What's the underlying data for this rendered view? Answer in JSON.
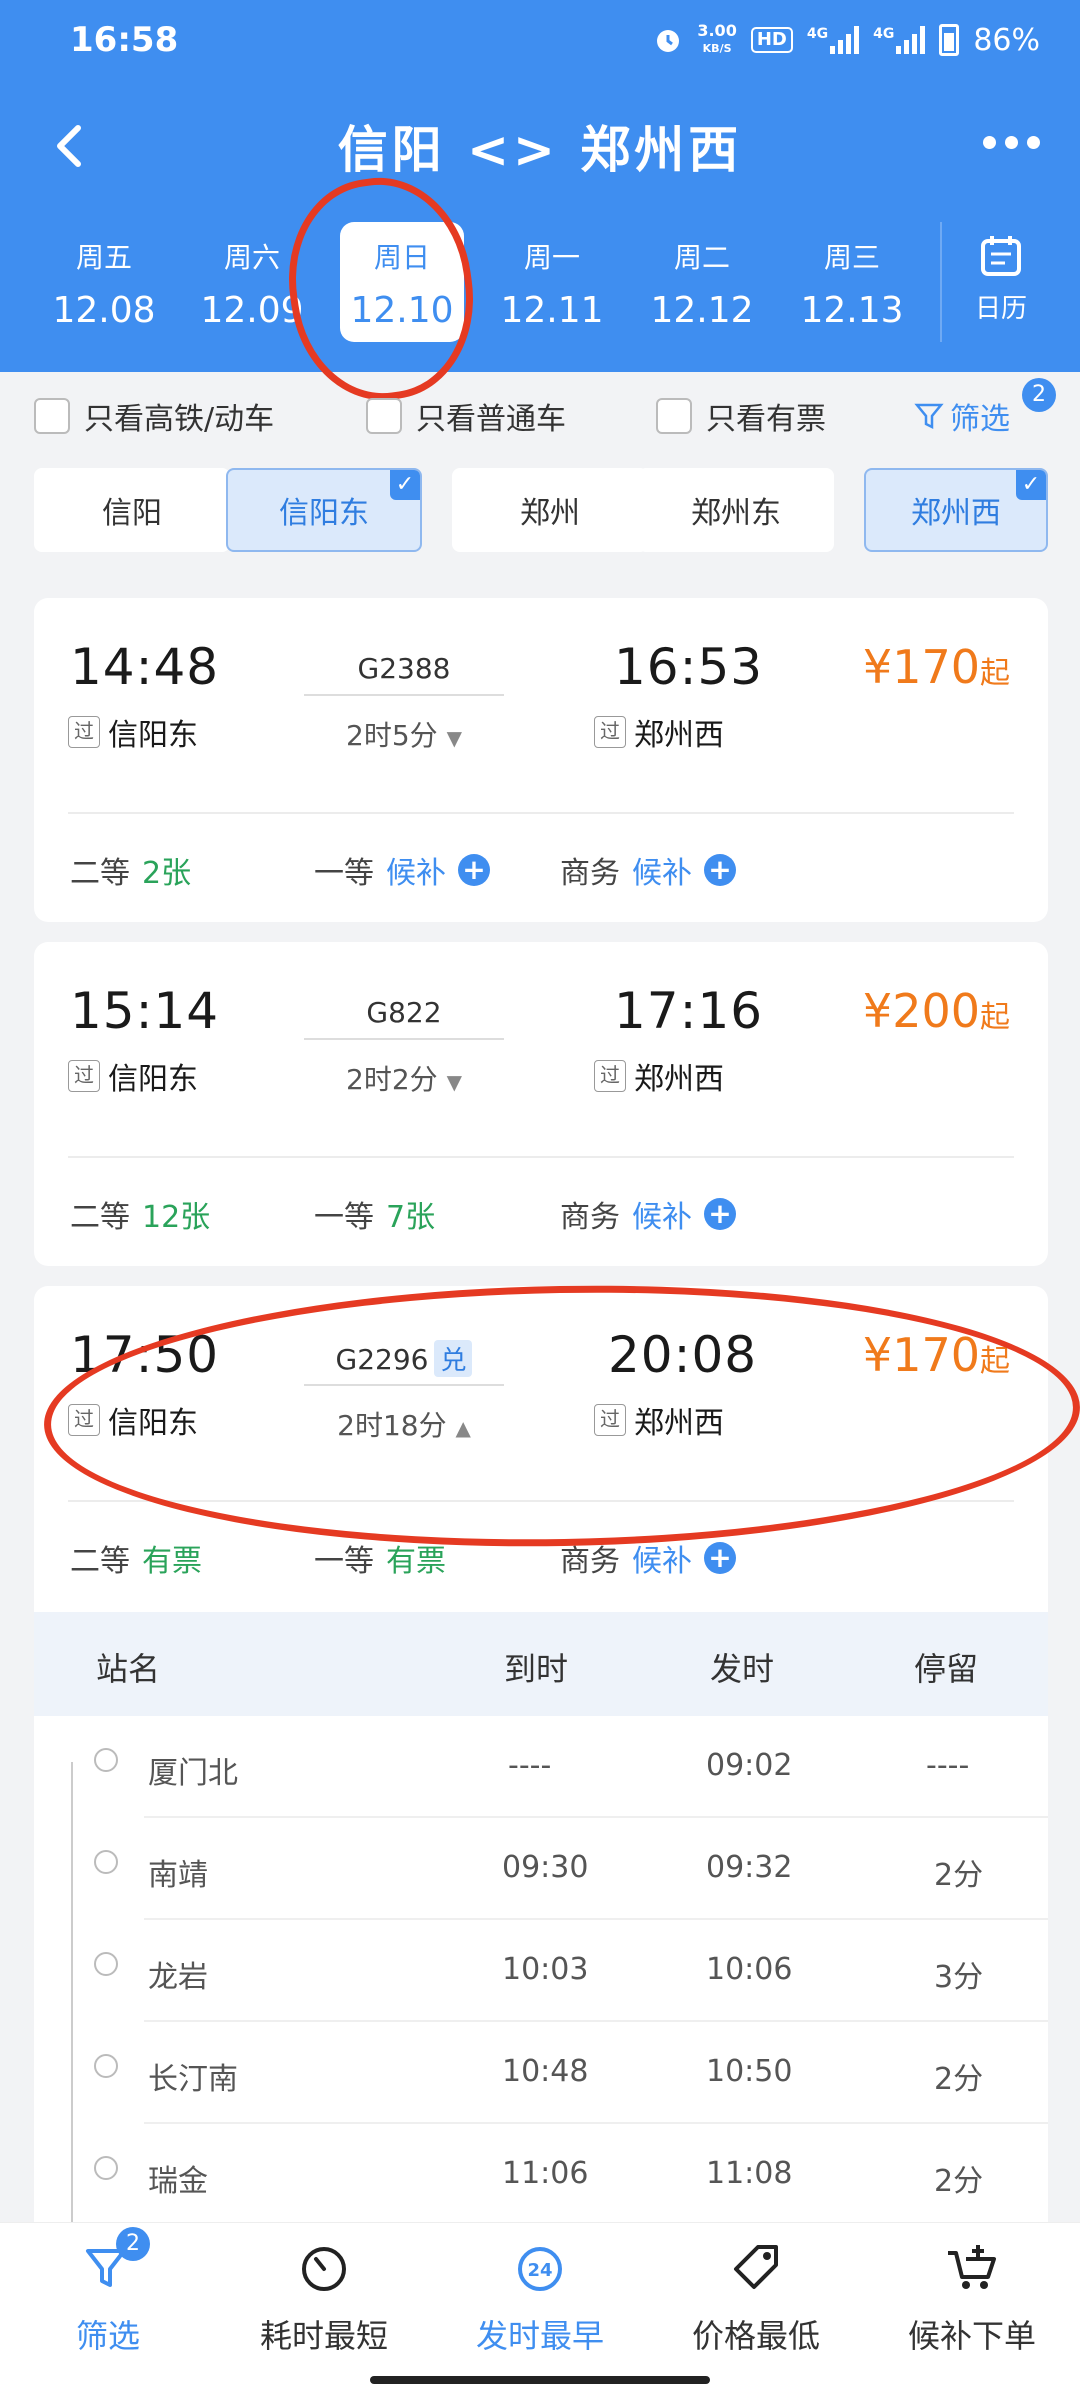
{
  "status_bar": {
    "time": "16:58",
    "speed_value": "3.00",
    "speed_unit": "KB/S",
    "hd_label": "HD",
    "net1": "4G",
    "net2": "4G",
    "battery": "86%"
  },
  "header": {
    "title": "信阳 <> 郑州西",
    "back_icon": "chevron-left-icon",
    "more_icon": "more-dots-icon"
  },
  "dates": [
    {
      "dow": "周五",
      "date": "12.08"
    },
    {
      "dow": "周六",
      "date": "12.09"
    },
    {
      "dow": "周日",
      "date": "12.10",
      "selected": true
    },
    {
      "dow": "周一",
      "date": "12.11"
    },
    {
      "dow": "周二",
      "date": "12.12"
    },
    {
      "dow": "周三",
      "date": "12.13"
    }
  ],
  "calendar": {
    "label": "日历",
    "icon": "calendar-icon"
  },
  "filters": {
    "gaotie": "只看高铁/动车",
    "putong": "只看普通车",
    "youpiao": "只看有票",
    "filter_label": "筛选",
    "filter_count": "2"
  },
  "stations": [
    {
      "name": "信阳",
      "selected": false
    },
    {
      "name": "信阳东",
      "selected": true
    },
    {
      "name": "郑州",
      "selected": false
    },
    {
      "name": "郑州东",
      "selected": false
    },
    {
      "name": "郑州西",
      "selected": true
    }
  ],
  "trains": [
    {
      "depart": "14:48",
      "code": "G2388",
      "arrive": "16:53",
      "duration": "2时5分",
      "price": "¥170",
      "price_suffix": "起",
      "from": "信阳东",
      "to": "郑州西",
      "pass": "过",
      "seats": [
        {
          "cls": "二等",
          "status": "2张"
        },
        {
          "cls": "一等",
          "status": "候补"
        },
        {
          "cls": "商务",
          "status": "候补"
        }
      ]
    },
    {
      "depart": "15:14",
      "code": "G822",
      "arrive": "17:16",
      "duration": "2时2分",
      "price": "¥200",
      "price_suffix": "起",
      "from": "信阳东",
      "to": "郑州西",
      "pass": "过",
      "seats": [
        {
          "cls": "二等",
          "status": "12张"
        },
        {
          "cls": "一等",
          "status": "7张"
        },
        {
          "cls": "商务",
          "status": "候补"
        }
      ]
    },
    {
      "depart": "17:50",
      "code": "G2296",
      "badge": "兑",
      "arrive": "20:08",
      "duration": "2时18分",
      "price": "¥170",
      "price_suffix": "起",
      "from": "信阳东",
      "to": "郑州西",
      "pass": "过",
      "seats": [
        {
          "cls": "二等",
          "status": "有票"
        },
        {
          "cls": "一等",
          "status": "有票"
        },
        {
          "cls": "商务",
          "status": "候补"
        }
      ]
    }
  ],
  "stops": {
    "headers": {
      "name": "站名",
      "arrive": "到时",
      "depart": "发时",
      "stay": "停留"
    },
    "rows": [
      {
        "name": "厦门北",
        "arrive": "----",
        "depart": "09:02",
        "stay": "----"
      },
      {
        "name": "南靖",
        "arrive": "09:30",
        "depart": "09:32",
        "stay": "2分"
      },
      {
        "name": "龙岩",
        "arrive": "10:03",
        "depart": "10:06",
        "stay": "3分"
      },
      {
        "name": "长汀南",
        "arrive": "10:48",
        "depart": "10:50",
        "stay": "2分"
      },
      {
        "name": "瑞金",
        "arrive": "11:06",
        "depart": "11:08",
        "stay": "2分"
      }
    ]
  },
  "bottom_tabs": [
    {
      "label": "筛选",
      "icon": "filter-icon",
      "active": true,
      "badge": "2"
    },
    {
      "label": "耗时最短",
      "icon": "timer-icon"
    },
    {
      "label": "发时最早",
      "icon": "clock-24-icon",
      "active": true
    },
    {
      "label": "价格最低",
      "icon": "price-tag-icon"
    },
    {
      "label": "候补下单",
      "icon": "cart-plus-icon"
    }
  ],
  "colors": {
    "primary": "#3f8ef0",
    "price": "#f07a1b",
    "available": "#2aa35a",
    "annotation": "#e53a22"
  }
}
